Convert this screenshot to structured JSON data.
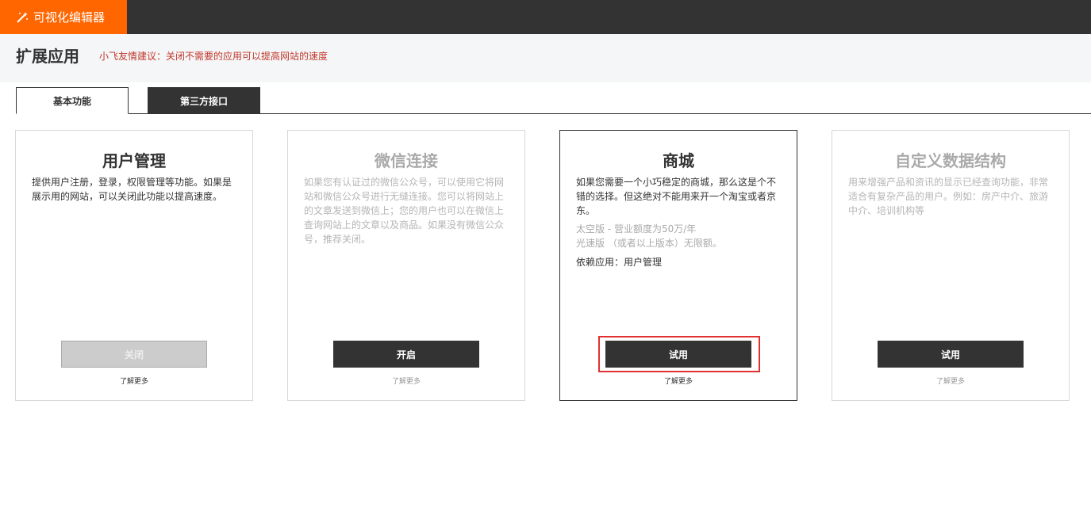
{
  "app": {
    "title": "可视化编辑器",
    "icon": "magic-wand-icon"
  },
  "page": {
    "title": "扩展应用",
    "tip": "小飞友情建议：关闭不需要的应用可以提高网站的速度"
  },
  "tabs": [
    {
      "label": "基本功能"
    },
    {
      "label": "第三方接口"
    }
  ],
  "cards": [
    {
      "title": "用户管理",
      "desc": "提供用户注册，登录，权限管理等功能。如果是展示用的网站，可以关闭此功能以提高速度。",
      "button": "关闭",
      "more": "了解更多"
    },
    {
      "title": "微信连接",
      "desc": "如果您有认证过的微信公众号，可以使用它将网站和微信公众号进行无缝连接。您可以将网站上的文章发送到微信上；您的用户也可以在微信上查询网站上的文章以及商品。如果没有微信公众号，推荐关闭。",
      "button": "开启",
      "more": "了解更多"
    },
    {
      "title": "商城",
      "desc": "如果您需要一个小巧稳定的商城，那么这是个不错的选择。但这绝对不能用来开一个淘宝或者京东。",
      "note1": "太空版 - 营业额度为50万/年",
      "note2": "光速版 （或者以上版本）无限额。",
      "dependency": "依赖应用：用户管理",
      "button": "试用",
      "more": "了解更多"
    },
    {
      "title": "自定义数据结构",
      "desc": "用来增强产品和资讯的显示已经查询功能，非常适合有复杂产品的用户。例如：房产中介、旅游中介、培训机构等",
      "button": "试用",
      "more": "了解更多"
    }
  ],
  "colors": {
    "brand": "#ff6600",
    "topbar": "#333333",
    "tip": "#c0392b",
    "highlight": "#e03030"
  }
}
